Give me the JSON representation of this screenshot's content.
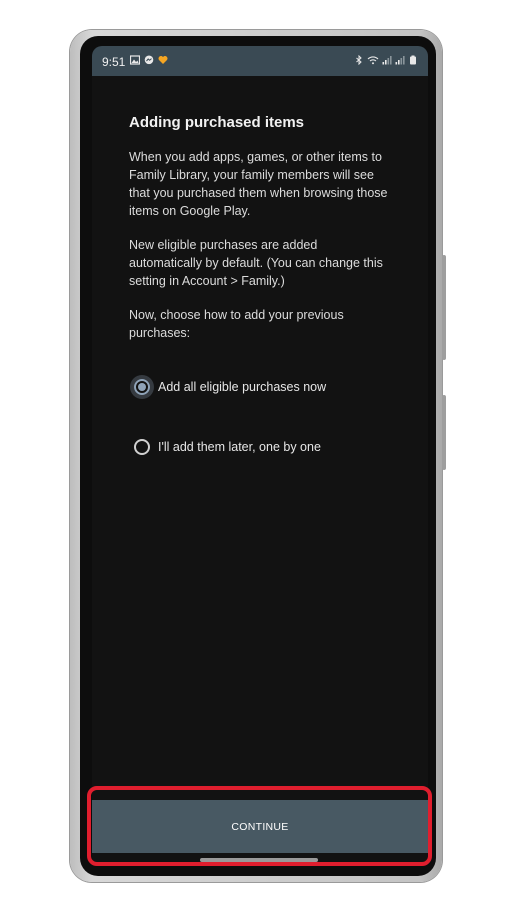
{
  "status_bar": {
    "time": "9:51",
    "left_icons": [
      "image-icon",
      "messenger-icon",
      "heart-icon"
    ],
    "right_icons": [
      "bluetooth-icon",
      "wifi-icon",
      "signal-icon",
      "signal-icon",
      "battery-icon"
    ]
  },
  "dialog": {
    "title": "Adding purchased items",
    "paragraphs": [
      "When you add apps, games, or other items to Family Library, your family members will see that you purchased them when browsing those items on Google Play.",
      "New eligible purchases are added automatically by default. (You can change this setting in Account > Family.)",
      "Now, choose how to add your previous purchases:"
    ],
    "options": [
      {
        "label": "Add all eligible purchases now",
        "selected": true
      },
      {
        "label": "I'll add them later, one by one",
        "selected": false
      }
    ]
  },
  "footer": {
    "continue_label": "CONTINUE"
  },
  "colors": {
    "background": "#121212",
    "status_bar": "#3a4a54",
    "footer_bar": "#485963",
    "radio_accent": "#8fa3b8",
    "highlight": "#e01e2e"
  }
}
